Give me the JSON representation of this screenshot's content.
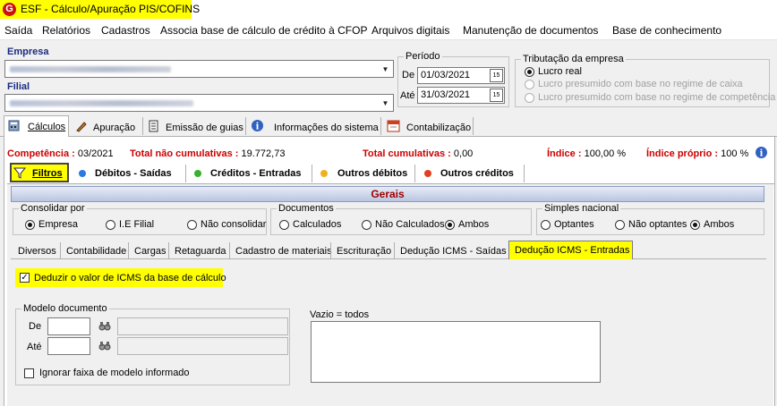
{
  "window": {
    "title": "ESF - Cálculo/Apuração PIS/COFINS"
  },
  "menu": [
    "Saída",
    "Relatórios",
    "Cadastros",
    "Associa base de cálculo de crédito à CFOP",
    "Arquivos digitais",
    "Manutenção de documentos",
    "Base de conhecimento"
  ],
  "empresa": {
    "label": "Empresa"
  },
  "filial": {
    "label": "Filial"
  },
  "periodo": {
    "legend": "Período",
    "de_label": "De",
    "de_value": "01/03/2021",
    "ate_label": "Até",
    "ate_value": "31/03/2021"
  },
  "tributacao": {
    "legend": "Tributação da empresa",
    "options": [
      "Lucro real",
      "Lucro presumido com base no regime de caixa",
      "Lucro presumido com base no regime de competência"
    ]
  },
  "main_tabs": [
    "Cálculos",
    "Apuração",
    "Emissão de guias",
    "Informações do sistema",
    "Contabilização"
  ],
  "summary": {
    "competencia_label": "Competência :",
    "competencia_value": "03/2021",
    "nao_cumul_label": "Total não cumulativas :",
    "nao_cumul_value": "19.772,73",
    "cumul_label": "Total cumulativas :",
    "cumul_value": "0,00",
    "indice_label": "Índice :",
    "indice_value": "100,00 %",
    "indice_proprio_label": "Índice próprio :",
    "indice_proprio_value": "100 %"
  },
  "sub_tabs": [
    "Filtros",
    "Débitos - Saídas",
    "Créditos - Entradas",
    "Outros débitos",
    "Outros créditos"
  ],
  "gerais": {
    "title": "Gerais"
  },
  "consolidar": {
    "legend": "Consolidar por",
    "options": [
      "Empresa",
      "I.E Filial",
      "Não consolidar"
    ]
  },
  "documentos": {
    "legend": "Documentos",
    "options": [
      "Calculados",
      "Não Calculados",
      "Ambos"
    ]
  },
  "simples": {
    "legend": "Simples nacional",
    "options": [
      "Optantes",
      "Não optantes",
      "Ambos"
    ]
  },
  "inner_tabs": [
    "Diversos",
    "Contabilidade",
    "Cargas",
    "Retaguarda",
    "Cadastro de materiais",
    "Escrituração",
    "Dedução ICMS - Saídas",
    "Dedução ICMS - Entradas"
  ],
  "deduzir": {
    "label": "Deduzir o valor de ICMS da base de cálculo"
  },
  "modelo": {
    "legend": "Modelo documento",
    "de_label": "De",
    "ate_label": "Até",
    "ignorar_label": "Ignorar faixa de modelo informado"
  },
  "vazio": {
    "label": "Vazio = todos"
  },
  "colors": {
    "highlight": "#ffff00",
    "accent_red": "#cc0000",
    "label_blue": "#1a2a80",
    "gerais_title": "#a00000"
  }
}
